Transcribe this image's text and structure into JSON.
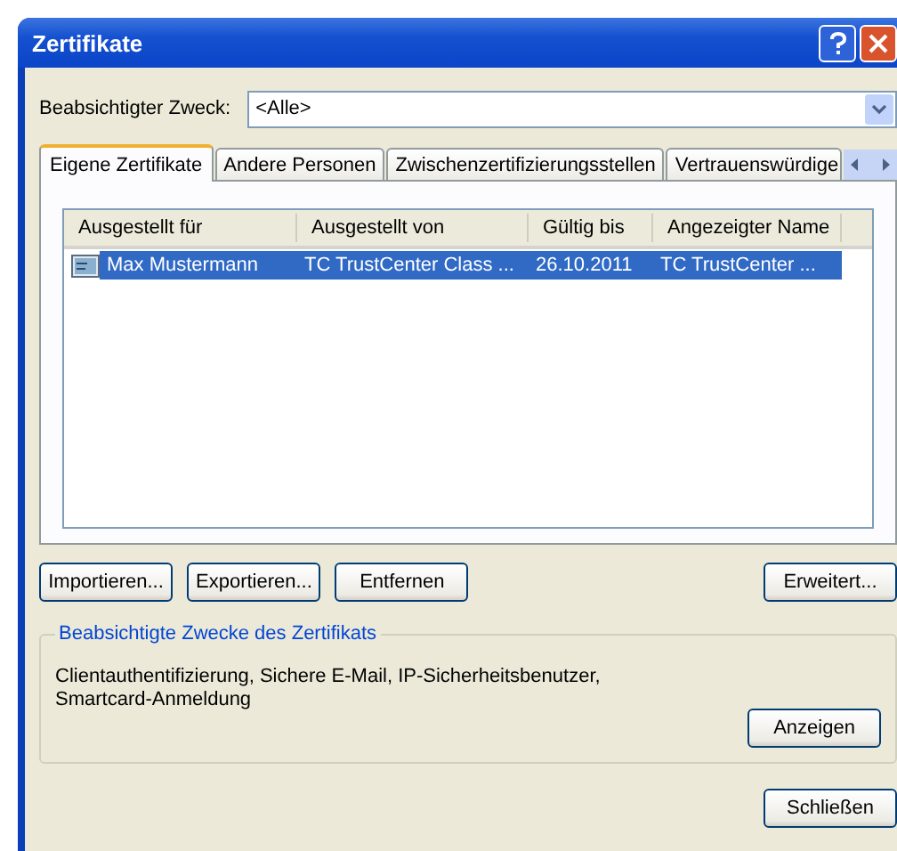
{
  "window": {
    "title": "Zertifikate"
  },
  "purpose": {
    "label": "Beabsichtigter Zweck:",
    "value": "<Alle>"
  },
  "tabs": [
    {
      "label": "Eigene Zertifikate",
      "selected": true
    },
    {
      "label": "Andere Personen",
      "selected": false
    },
    {
      "label": "Zwischenzertifizierungsstellen",
      "selected": false
    },
    {
      "label": "Vertrauenswürdige",
      "selected": false
    }
  ],
  "table": {
    "columns": [
      "Ausgestellt für",
      "Ausgestellt von",
      "Gültig bis",
      "Angezeigter Name"
    ],
    "rows": [
      {
        "cells": [
          "Max Mustermann",
          "TC TrustCenter Class ...",
          "26.10.2011",
          "TC TrustCenter ..."
        ],
        "selected": true
      }
    ]
  },
  "buttons": [
    "Importieren...",
    "Exportieren...",
    "Entfernen"
  ],
  "advanced_button": "Erweitert...",
  "purposes_group": {
    "title": "Beabsichtigte Zwecke des Zertifikats",
    "text": "Clientauthentifizierung, Sichere E-Mail, IP-Sicherheitsbenutzer, Smartcard-Anmeldung",
    "button": "Anzeigen"
  },
  "close_button": "Schließen"
}
